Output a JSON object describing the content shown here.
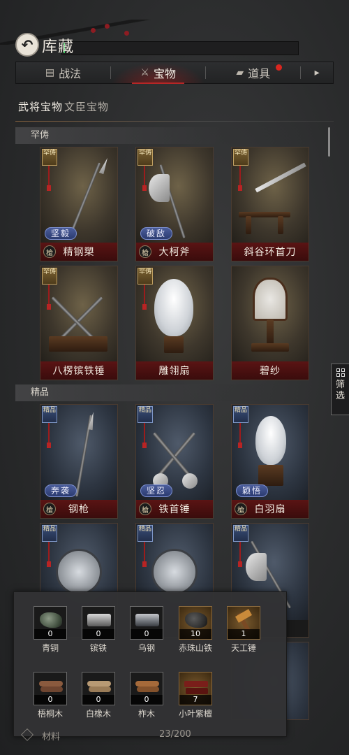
{
  "header": {
    "back_icon": "back-arrow-icon",
    "title": "库藏"
  },
  "tabs": [
    {
      "label": "战法",
      "icon": "scroll-icon"
    },
    {
      "label": "宝物",
      "icon": "weapon-rack-icon"
    },
    {
      "label": "道具",
      "icon": "ingot-icon"
    }
  ],
  "tabs_more_icon": "chevron-right-icon",
  "sub_tabs": [
    {
      "label": "武将宝物"
    },
    {
      "label": "文臣宝物"
    }
  ],
  "sections": {
    "legendary": {
      "title": "罕俦",
      "rank_tag": "罕俦",
      "items": [
        {
          "name": "精钢槊",
          "skill": "坚毅",
          "badge": "槍"
        },
        {
          "name": "大柯斧",
          "skill": "破敌",
          "badge": "槍"
        },
        {
          "name": "斜谷环首刀",
          "skill": "",
          "badge": ""
        },
        {
          "name": "八楞镔铁锤",
          "skill": "",
          "badge": ""
        },
        {
          "name": "雕翎扇",
          "skill": "",
          "badge": ""
        },
        {
          "name": "碧纱",
          "skill": "",
          "badge": ""
        }
      ]
    },
    "fine": {
      "title": "精品",
      "rank_tag": "精品",
      "items": [
        {
          "name": "钢枪",
          "skill": "奔袭",
          "badge": "槍"
        },
        {
          "name": "铁首锤",
          "skill": "坚忍",
          "badge": "槍"
        },
        {
          "name": "白羽扇",
          "skill": "颖悟",
          "badge": "槍"
        }
      ]
    }
  },
  "filter": {
    "label_line1": "筛",
    "label_line2": "选",
    "icon": "grid-icon"
  },
  "materials": [
    {
      "name": "青铜",
      "count": "0"
    },
    {
      "name": "镔铁",
      "count": "0"
    },
    {
      "name": "乌钢",
      "count": "0"
    },
    {
      "name": "赤珠山铁",
      "count": "10"
    },
    {
      "name": "天工锤",
      "count": "1"
    },
    {
      "name": "梧桐木",
      "count": "0"
    },
    {
      "name": "白橡木",
      "count": "0"
    },
    {
      "name": "柞木",
      "count": "0"
    },
    {
      "name": "小叶紫檀",
      "count": "7"
    }
  ],
  "bottom": {
    "label": "材料",
    "count": "23/200"
  },
  "colors": {
    "accent_red": "#b72626",
    "legend_tag": "#7a6132",
    "fine_tag": "#3a4e78",
    "skill_pill": "#4b5d9b"
  }
}
